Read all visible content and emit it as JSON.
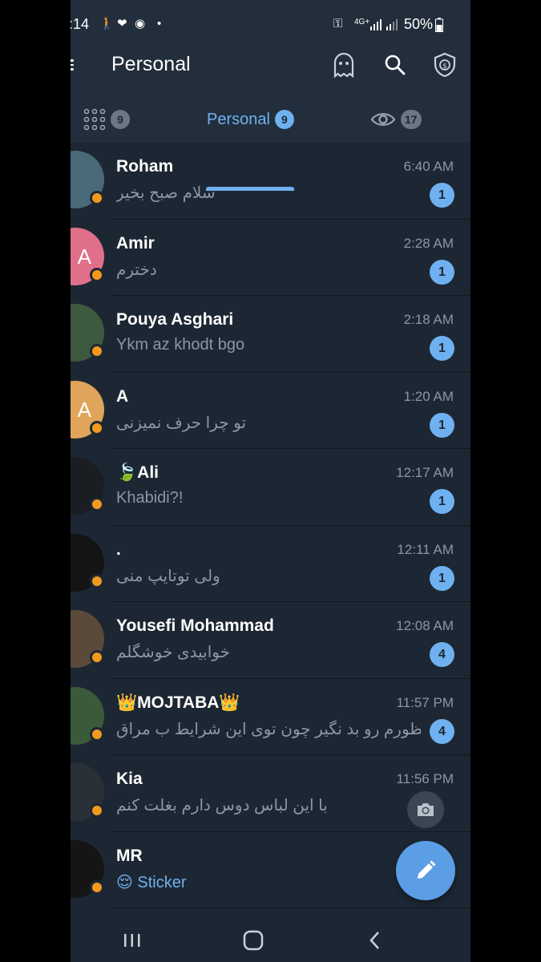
{
  "status_bar": {
    "time": ":14",
    "network": "4G+",
    "battery": "50%"
  },
  "header": {
    "title": "Personal",
    "icons": [
      "menu-icon",
      "ghost-icon",
      "search-icon",
      "shield-icon"
    ]
  },
  "tabs": [
    {
      "label": "",
      "icon": "grid-icon",
      "badge": "9"
    },
    {
      "label": "Personal",
      "badge": "9",
      "active": true
    },
    {
      "label": "",
      "icon": "eye-icon",
      "badge": "17"
    }
  ],
  "chats": [
    {
      "name": "Roham",
      "time": "6:40 AM",
      "message": "سلام صبح بخیر",
      "unread": "1",
      "avatar_color": "#4a6a7a"
    },
    {
      "name": "Amir",
      "time": "2:28 AM",
      "message": "دخترم",
      "unread": "1",
      "avatar_letter": "A",
      "avatar_color": "#e0708a"
    },
    {
      "name": "Pouya Asghari",
      "time": "2:18 AM",
      "message": "Ykm az khodt bgo",
      "unread": "1",
      "avatar_color": "#3d5a3e"
    },
    {
      "name": "A",
      "time": "1:20 AM",
      "message": "تو چرا حرف نمیزنی",
      "unread": "1",
      "avatar_letter": "A",
      "avatar_color": "#e0a55a"
    },
    {
      "name": "🍃Ali",
      "time": "12:17 AM",
      "message": "Khabidi?!",
      "unread": "1",
      "avatar_color": "#1a1e22"
    },
    {
      "name": ".",
      "time": "12:11 AM",
      "message": "ولی توتایپ منی",
      "unread": "1",
      "avatar_color": "#141414"
    },
    {
      "name": "Yousefi Mohammad",
      "time": "12:08 AM",
      "message": "خوابیدی خوشگلم",
      "unread": "4",
      "avatar_color": "#5a4a3a"
    },
    {
      "name": "👑MOJTABA👑",
      "time": "11:57 PM",
      "message": "منظورم رو بد نگیر چون توی این شرایط ب مراق...",
      "unread": "4",
      "avatar_color": "#3a5a3a"
    },
    {
      "name": "Kia",
      "time": "11:56 PM",
      "message": "با این لباس دوس دارم بغلت کنم",
      "unread": "",
      "avatar_color": "#2a3038"
    },
    {
      "name": "MR",
      "time": "",
      "message": "😌 Sticker",
      "unread": "",
      "avatar_color": "#151515",
      "sticker": true
    }
  ],
  "colors": {
    "background": "#1d2733",
    "header": "#232e3c",
    "accent": "#6fb1f0",
    "online": "#f29a1e"
  }
}
